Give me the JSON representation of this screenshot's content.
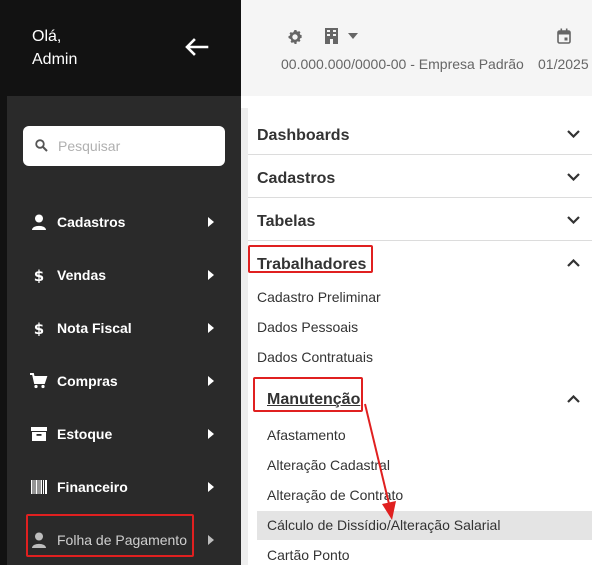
{
  "user": {
    "greeting_line1": "Olá,",
    "greeting_line2": "Admin"
  },
  "topbar": {
    "company": "00.000.000/0000-00 - Empresa Padrão",
    "period": "01/2025"
  },
  "search": {
    "placeholder": "Pesquisar"
  },
  "sidebar": {
    "items": [
      {
        "label": "Cadastros",
        "icon": "user-icon"
      },
      {
        "label": "Vendas",
        "icon": "dollar-icon"
      },
      {
        "label": "Nota Fiscal",
        "icon": "dollar-icon"
      },
      {
        "label": "Compras",
        "icon": "cart-icon"
      },
      {
        "label": "Estoque",
        "icon": "archive-icon"
      },
      {
        "label": "Financeiro",
        "icon": "barcode-icon"
      },
      {
        "label": "Folha de Pagamento",
        "icon": "user-icon",
        "highlighted": true
      }
    ]
  },
  "submenu": {
    "sections": [
      {
        "label": "Dashboards",
        "expanded": false
      },
      {
        "label": "Cadastros",
        "expanded": false
      },
      {
        "label": "Tabelas",
        "expanded": false
      },
      {
        "label": "Trabalhadores",
        "expanded": true,
        "highlighted": true
      }
    ],
    "trabalhadores_items": [
      "Cadastro Preliminar",
      "Dados Pessoais",
      "Dados Contratuais"
    ],
    "manutencao": {
      "label": "Manutenção",
      "expanded": true,
      "items": [
        "Afastamento",
        "Alteração Cadastral",
        "Alteração de Contrato",
        "Cálculo de Dissídio/Alteração Salarial",
        "Cartão Ponto"
      ],
      "active_item": "Cálculo de Dissídio/Alteração Salarial"
    }
  },
  "colors": {
    "highlight": "#e02020",
    "sidebar_bg": "#2a2a2a",
    "header_bg": "#121212",
    "active_row": "#e4e4e4"
  }
}
